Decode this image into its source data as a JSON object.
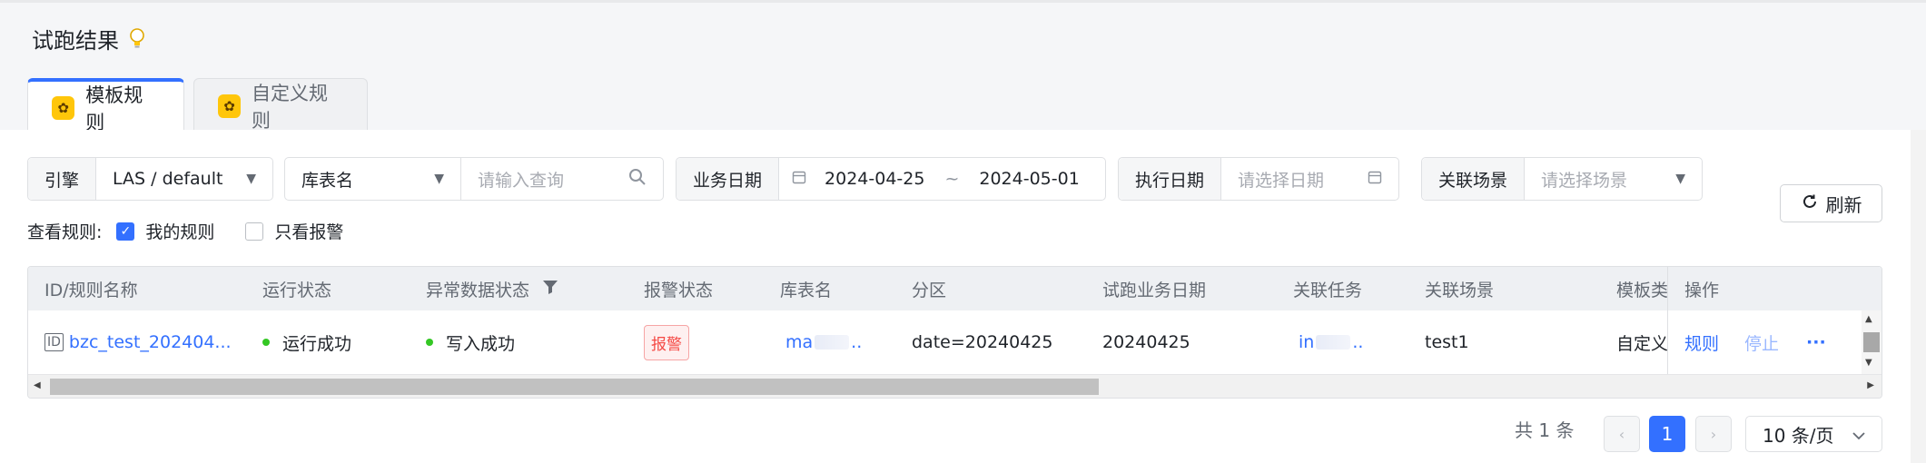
{
  "page": {
    "title": "试跑结果",
    "title_icon": "lightbulb-icon"
  },
  "tabs": [
    {
      "label": "模板规则",
      "active": true,
      "icon": "rule-bee-icon"
    },
    {
      "label": "自定义规则",
      "active": false,
      "icon": "rule-bee-icon"
    }
  ],
  "filters": {
    "engine": {
      "label": "引擎",
      "value": "LAS / default"
    },
    "table": {
      "label": "库表名",
      "placeholder": "请输入查询"
    },
    "biz_date": {
      "label": "业务日期",
      "start": "2024-04-25",
      "sep": "~",
      "end": "2024-05-01"
    },
    "exec_date": {
      "label": "执行日期",
      "placeholder": "请选择日期"
    },
    "scene": {
      "label": "关联场景",
      "placeholder": "请选择场景"
    }
  },
  "refresh_label": "刷新",
  "view_rules": {
    "label": "查看规则:",
    "mine": "我的规则",
    "mine_checked": true,
    "alarm_only": "只看报警",
    "alarm_checked": false
  },
  "table": {
    "headers": [
      "ID/规则名称",
      "运行状态",
      "异常数据状态",
      "报警状态",
      "库表名",
      "分区",
      "试跑业务日期",
      "关联任务",
      "关联场景",
      "模板类",
      "操作"
    ],
    "row": {
      "id_badge": "ID",
      "name": "bzc_test_202404...",
      "run_status": "运行成功",
      "abnormal_status": "写入成功",
      "alarm": "报警",
      "table_name_prefix": "ma",
      "table_name_suffix": "..",
      "partition": "date=20240425",
      "trial_date": "20240425",
      "task_prefix": "in",
      "task_suffix": "..",
      "scene": "test1",
      "template_type": "自定义",
      "op_rule": "规则",
      "op_stop": "停止",
      "op_more": "···"
    }
  },
  "pagination": {
    "total": "共 1 条",
    "current": "1",
    "page_size": "10 条/页"
  },
  "colors": {
    "accent": "#3370ff",
    "success": "#34c724",
    "danger": "#f54a45"
  }
}
